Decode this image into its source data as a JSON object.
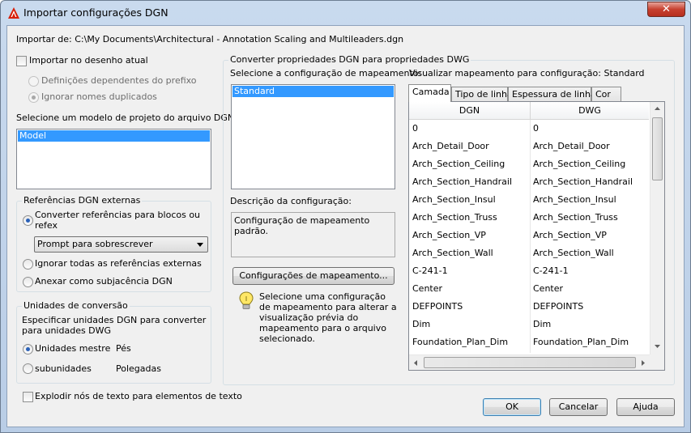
{
  "window": {
    "title": "Importar configurações DGN",
    "close_glyph": "✕"
  },
  "import_from": "Importar de: C:\\My Documents\\Architectural - Annotation Scaling and Multileaders.dgn",
  "left": {
    "import_current_drawing": "Importar no desenho atual",
    "prefix_dependent": "Definições dependentes do prefixo",
    "ignore_duplicates": "Ignorar nomes duplicados",
    "design_model_label": "Selecione um modelo de projeto do arquivo DGN:",
    "design_models": [
      "Model"
    ],
    "xref_group_title": "Referências DGN externas",
    "xref_convert": "Converter referências para blocos ou refex",
    "xref_prompt_option": "Prompt para sobrescrever",
    "xref_ignore": "Ignorar todas as referências externas",
    "xref_attach": "Anexar como subjacência DGN",
    "units_group_title": "Unidades de conversão",
    "units_desc": "Especificar unidades DGN para converter para unidades DWG",
    "master_units": "Unidades mestre",
    "master_units_value": "Pés",
    "sub_units": "subunidades",
    "sub_units_value": "Polegadas",
    "explode_text": "Explodir nós de texto para elementos de texto"
  },
  "mapping": {
    "group_title": "Converter propriedades DGN para propriedades DWG",
    "select_label": "Selecione a configuração de mapeamento:",
    "setups": [
      "Standard"
    ],
    "desc_label": "Descrição da configuração:",
    "desc_text": "Configuração de mapeamento padrão.",
    "setups_button": "Configurações de mapeamento...",
    "hint": "Selecione uma configuração de mapeamento para alterar a visualização prévia do mapeamento para o arquivo selecionado.",
    "preview_label": "Visualizar mapeamento para configuração: Standard",
    "tabs": [
      "Camada",
      "Tipo de linha",
      "Espessura de linha",
      "Cor"
    ],
    "columns": [
      "DGN",
      "DWG"
    ],
    "rows": [
      [
        "0",
        "0"
      ],
      [
        "Arch_Detail_Door",
        "Arch_Detail_Door"
      ],
      [
        "Arch_Section_Ceiling",
        "Arch_Section_Ceiling"
      ],
      [
        "Arch_Section_Handrail",
        "Arch_Section_Handrail"
      ],
      [
        "Arch_Section_Insul",
        "Arch_Section_Insul"
      ],
      [
        "Arch_Section_Truss",
        "Arch_Section_Truss"
      ],
      [
        "Arch_Section_VP",
        "Arch_Section_VP"
      ],
      [
        "Arch_Section_Wall",
        "Arch_Section_Wall"
      ],
      [
        "C-241-1",
        "C-241-1"
      ],
      [
        "Center",
        "Center"
      ],
      [
        "DEFPOINTS",
        "DEFPOINTS"
      ],
      [
        "Dim",
        "Dim"
      ],
      [
        "Foundation_Plan_Dim",
        "Foundation_Plan_Dim"
      ]
    ]
  },
  "buttons": {
    "ok": "OK",
    "cancel": "Cancelar",
    "help": "Ajuda"
  },
  "colors": {
    "selection": "#3399ff",
    "close_button": "#c7402f",
    "app_icon": "#d81e05"
  }
}
